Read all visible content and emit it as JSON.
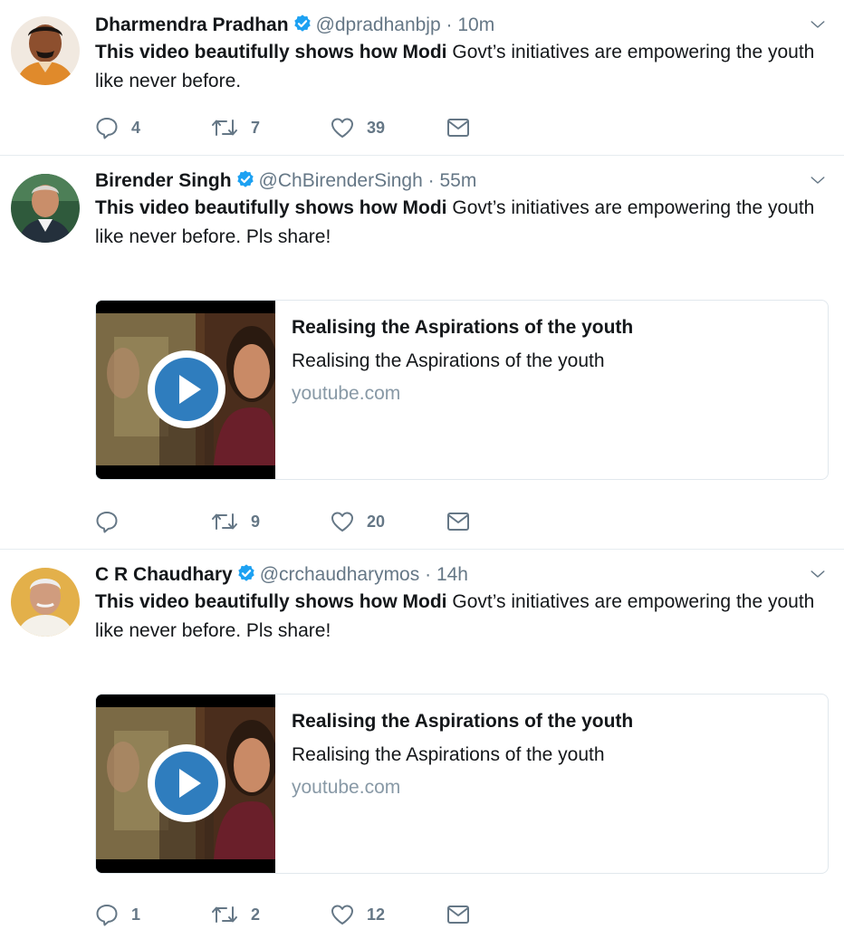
{
  "tweets": [
    {
      "name": "Dharmendra Pradhan",
      "handle": "@dpradhanbjp",
      "dot": "·",
      "time": "10m",
      "text_bold": "This video beautifully shows how Modi",
      "text_rest": " Govt’s initiatives are empowering the youth like never before.",
      "replies": "4",
      "retweets": "7",
      "likes": "39"
    },
    {
      "name": "Birender Singh",
      "handle": "@ChBirenderSingh",
      "dot": "·",
      "time": "55m",
      "text_bold": "This video beautifully shows how Modi",
      "text_rest": " Govt’s initiatives are empowering the youth like never before. Pls share!",
      "card": {
        "title": "Realising the Aspirations of the youth",
        "description": "Realising the Aspirations of the youth",
        "domain": "youtube.com"
      },
      "replies": "",
      "retweets": "9",
      "likes": "20"
    },
    {
      "name": "C R Chaudhary",
      "handle": "@crchaudharymos",
      "dot": "·",
      "time": "14h",
      "text_bold": "This video beautifully shows how Modi",
      "text_rest": " Govt’s initiatives are empowering the youth like never before. Pls share!",
      "card": {
        "title": "Realising the Aspirations of the youth",
        "description": "Realising the Aspirations of the youth",
        "domain": "youtube.com"
      },
      "replies": "1",
      "retweets": "2",
      "likes": "12"
    }
  ],
  "colors": {
    "verified": "#1da1f2",
    "muted": "#657786",
    "border": "#e6ecf0",
    "play": "#2f7dbe"
  },
  "icons": [
    "verified-badge-icon",
    "chevron-down-icon",
    "reply-icon",
    "retweet-icon",
    "like-icon",
    "message-icon",
    "play-icon"
  ]
}
